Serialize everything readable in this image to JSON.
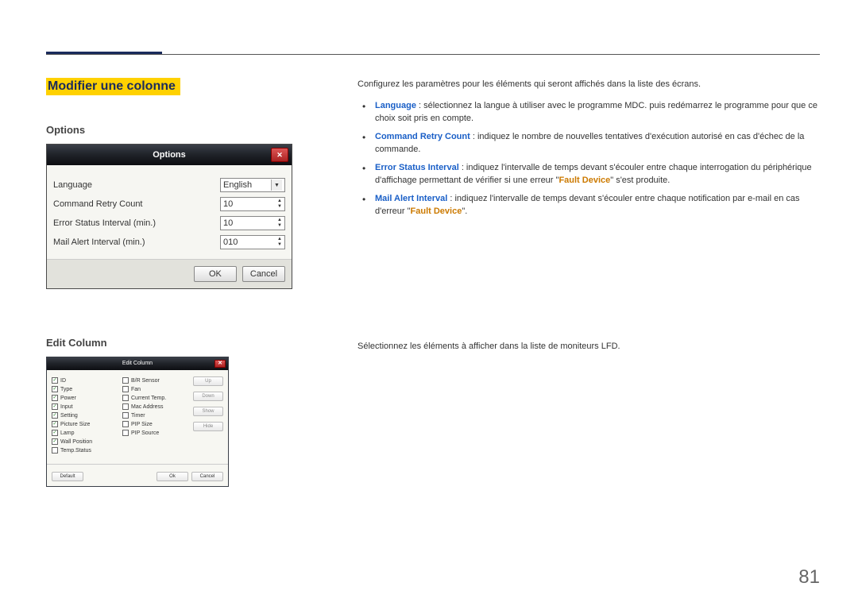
{
  "section_title": "Modifier une colonne",
  "options": {
    "heading": "Options",
    "dialog_title": "Options",
    "rows": {
      "language_label": "Language",
      "language_value": "English",
      "retry_label": "Command Retry Count",
      "retry_value": "10",
      "error_interval_label": "Error Status Interval (min.)",
      "error_interval_value": "10",
      "mail_interval_label": "Mail Alert Interval (min.)",
      "mail_interval_value": "010"
    },
    "buttons": {
      "ok": "OK",
      "cancel": "Cancel"
    }
  },
  "edit_column": {
    "heading": "Edit Column",
    "dialog_title": "Edit Column",
    "col1": [
      {
        "label": "ID",
        "checked": true
      },
      {
        "label": "Type",
        "checked": true
      },
      {
        "label": "Power",
        "checked": true
      },
      {
        "label": "Input",
        "checked": true
      },
      {
        "label": "Setting",
        "checked": true
      },
      {
        "label": "Picture Size",
        "checked": true
      },
      {
        "label": "Lamp",
        "checked": true
      },
      {
        "label": "Wall Position",
        "checked": true
      },
      {
        "label": "Temp.Status",
        "checked": false
      }
    ],
    "col2": [
      {
        "label": "B/R Sensor",
        "checked": false
      },
      {
        "label": "Fan",
        "checked": false
      },
      {
        "label": "Current Temp.",
        "checked": false
      },
      {
        "label": "Mac Address",
        "checked": false
      },
      {
        "label": "Timer",
        "checked": false
      },
      {
        "label": "PIP Size",
        "checked": false
      },
      {
        "label": "PIP Source",
        "checked": false
      }
    ],
    "side_buttons": {
      "up": "Up",
      "down": "Down",
      "show": "Show",
      "hide": "Hide"
    },
    "buttons": {
      "default": "Default",
      "ok": "Ok",
      "cancel": "Cancel"
    }
  },
  "right_text": {
    "intro": "Configurez les paramètres pour les éléments qui seront affichés dans la liste des écrans.",
    "items": {
      "lang_kw": "Language",
      "lang_txt": " : sélectionnez la langue à utiliser avec le programme MDC. puis redémarrez le programme pour que ce choix soit pris en compte.",
      "retry_kw": "Command Retry Count",
      "retry_txt": " : indiquez le nombre de nouvelles tentatives d'exécution autorisé en cas d'échec de la commande.",
      "error_kw": "Error Status Interval",
      "error_txt_a": " : indiquez l'intervalle de temps devant s'écouler entre chaque interrogation du périphérique d'affichage permettant de vérifier si une erreur \"",
      "error_kw2": "Fault Device",
      "error_txt_b": "\" s'est produite.",
      "mail_kw": "Mail Alert Interval",
      "mail_txt_a": " : indiquez l'intervalle de temps devant s'écouler entre chaque notification par e-mail en cas d'erreur \"",
      "mail_kw2": "Fault Device",
      "mail_txt_b": "\"."
    },
    "edit_intro": "Sélectionnez les éléments à afficher dans la liste de moniteurs LFD."
  },
  "page_number": "81"
}
